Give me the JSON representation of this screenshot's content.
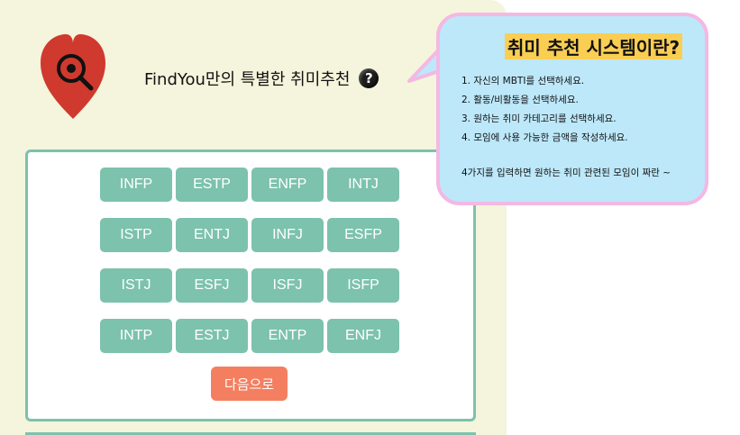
{
  "header": {
    "title": "FindYou만의 특별한 취미추천",
    "help_icon": "question-circle-icon"
  },
  "logo": {
    "icon": "heart-search-icon",
    "color": "#d0392e"
  },
  "mbti_options": [
    "INFP",
    "ESTP",
    "ENFP",
    "INTJ",
    "ISTP",
    "ENTJ",
    "INFJ",
    "ESFP",
    "ISTJ",
    "ESFJ",
    "ISFJ",
    "ISFP",
    "INTP",
    "ESTJ",
    "ENTP",
    "ENFJ"
  ],
  "next_button": {
    "label": "다음으로"
  },
  "info_bubble": {
    "title": "취미 추천 시스템이란?",
    "steps": [
      "1. 자신의 MBTI를 선택하세요.",
      "2. 활동/비활동을 선택하세요.",
      "3. 원하는 취미 카테고리를 선택하세요.",
      "4. 모임에 사용 가능한 금액을 작성하세요."
    ],
    "summary": "4가지를 입력하면 원하는 취미 관련된 모임이 짜란 ~"
  },
  "colors": {
    "panel_bg": "#f5f4dc",
    "accent": "#7cc2ad",
    "button": "#f47f60",
    "bubble_bg": "#bde8fa",
    "bubble_border": "#f4b8e3",
    "highlight": "#f9ce53"
  }
}
